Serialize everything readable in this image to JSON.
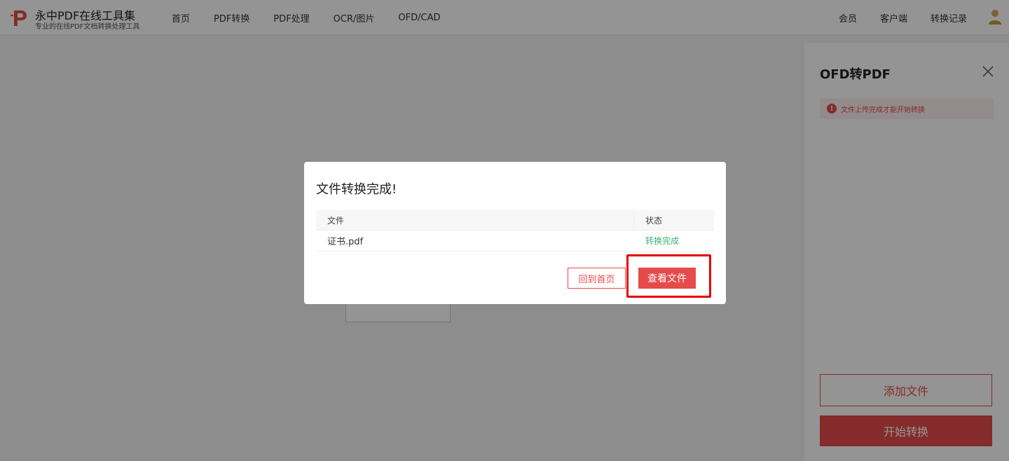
{
  "header": {
    "logo_title": "永中PDF在线工具集",
    "logo_subtitle": "专业的在线PDF文档转换处理工具",
    "nav": [
      "首页",
      "PDF转换",
      "PDF处理",
      "OCR/图片",
      "OFD/CAD"
    ],
    "right_nav": [
      "会员",
      "客户端",
      "转换记录"
    ]
  },
  "side_panel": {
    "title": "OFD转PDF",
    "alert": "文件上传完成才能开始转换",
    "add_button": "添加文件",
    "start_button": "开始转换"
  },
  "modal": {
    "title": "文件转换完成!",
    "columns": {
      "file": "文件",
      "status": "状态"
    },
    "rows": [
      {
        "file": "证书.pdf",
        "status": "转换完成"
      }
    ],
    "home_button": "回到首页",
    "view_button": "查看文件"
  },
  "colors": {
    "accent": "#e64b4b",
    "success": "#3cb371",
    "highlight": "#e60000"
  }
}
